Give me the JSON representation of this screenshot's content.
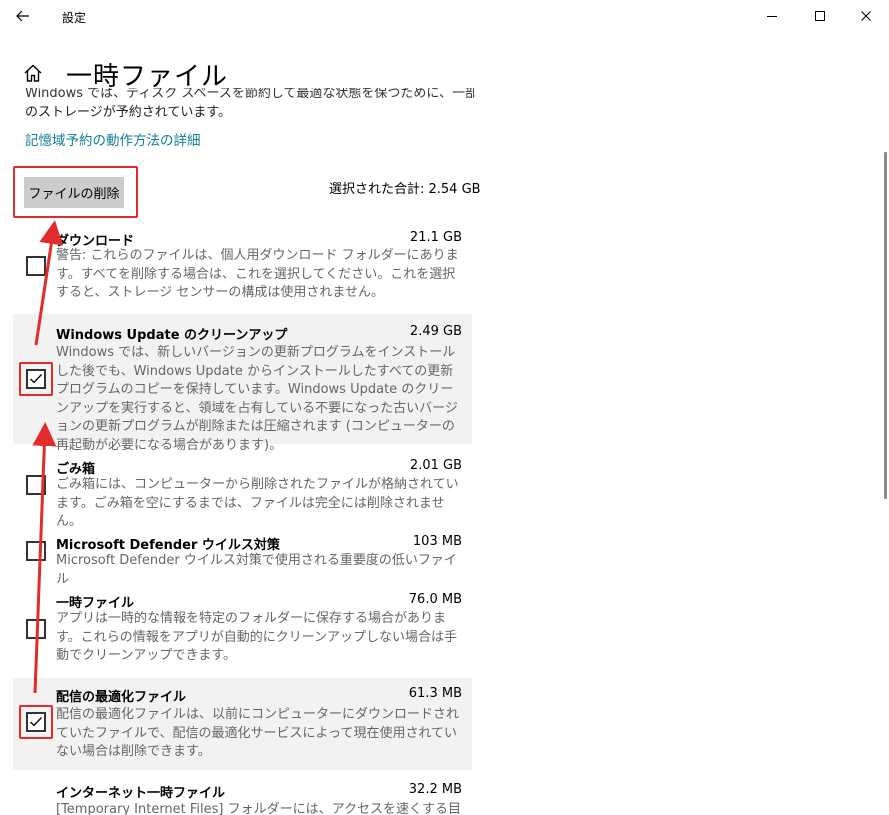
{
  "window": {
    "title": "設定",
    "back_icon": "back-arrow-icon",
    "controls": {
      "minimize": "minimize-icon",
      "maximize": "maximize-icon",
      "close": "close-icon"
    }
  },
  "page": {
    "title": "一時ファイル",
    "home_icon": "home-icon",
    "intro_partial": "Windows では、ディスク スペースを節約して最適な状態を保つために、一部",
    "intro": "のストレージが予約されています。",
    "learn_link": "記憶域予約の動作方法の詳細"
  },
  "toolbar": {
    "delete_label": "ファイルの削除",
    "total_label": "選択された合計: 2.54 GB"
  },
  "items": [
    {
      "name": "ダウンロード",
      "size": "21.1 GB",
      "checked": false,
      "desc": "警告: これらのファイルは、個人用ダウンロード フォルダーにあります。すべてを削除する場合は、これを選択してください。これを選択すると、ストレージ センサーの構成は使用されません。"
    },
    {
      "name": "Windows Update のクリーンアップ",
      "size": "2.49 GB",
      "checked": true,
      "desc": "Windows では、新しいバージョンの更新プログラムをインストールした後でも、Windows Update からインストールしたすべての更新プログラムのコピーを保持しています。Windows Update のクリーンアップを実行すると、領域を占有している不要になった古いバージョンの更新プログラムが削除または圧縮されます (コンピューターの再起動が必要になる場合があります)。"
    },
    {
      "name": "ごみ箱",
      "size": "2.01 GB",
      "checked": false,
      "desc": "ごみ箱には、コンピューターから削除されたファイルが格納されています。ごみ箱を空にするまでは、ファイルは完全には削除されません。"
    },
    {
      "name": "Microsoft Defender ウイルス対策",
      "size": "103 MB",
      "checked": false,
      "desc": "Microsoft Defender ウイルス対策で使用される重要度の低いファイル"
    },
    {
      "name": "一時ファイル",
      "size": "76.0 MB",
      "checked": false,
      "desc": "アプリは一時的な情報を特定のフォルダーに保存する場合があります。これらの情報をアプリが自動的にクリーンアップしない場合は手動でクリーンアップできます。"
    },
    {
      "name": "配信の最適化ファイル",
      "size": "61.3 MB",
      "checked": true,
      "desc": "配信の最適化ファイルは、以前にコンピューターにダウンロードされていたファイルで、配信の最適化サービスによって現在使用されていない場合は削除できます。"
    },
    {
      "name": "インターネット一時ファイル",
      "size": "32.2 MB",
      "checked": false,
      "desc": "[Temporary Internet Files] フォルダーには、アクセスを速くする目的で、"
    }
  ],
  "annotation_color": "#e22b2b"
}
